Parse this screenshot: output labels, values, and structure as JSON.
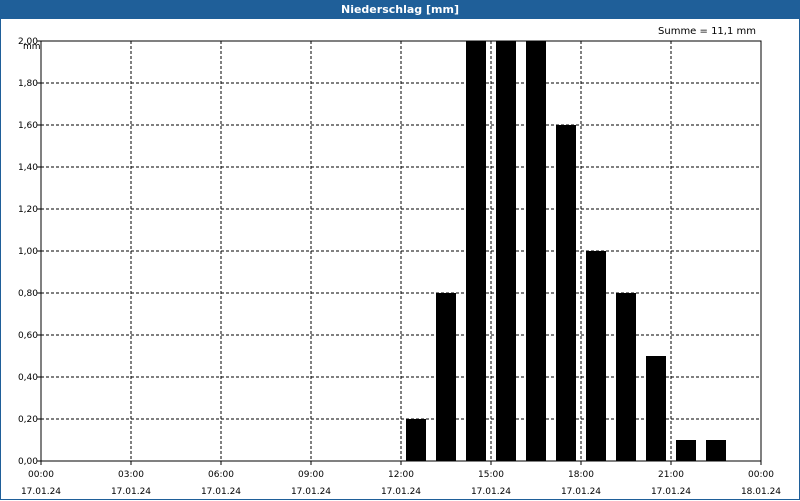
{
  "window": {
    "title": "Niederschlag [mm]"
  },
  "summary": {
    "text": "Summe = 11,1 mm"
  },
  "chart_data": {
    "type": "bar",
    "title": "Niederschlag [mm]",
    "ylabel": "mm",
    "xlabel": "",
    "ylim": [
      0,
      2.0
    ],
    "y_ticks": [
      "0,00",
      "0,20",
      "0,40",
      "0,60",
      "0,80",
      "1,00",
      "1,20",
      "1,40",
      "1,60",
      "1,80",
      "2,00"
    ],
    "x_ticks": [
      {
        "time": "00:00",
        "date": "17.01.24"
      },
      {
        "time": "03:00",
        "date": "17.01.24"
      },
      {
        "time": "06:00",
        "date": "17.01.24"
      },
      {
        "time": "09:00",
        "date": "17.01.24"
      },
      {
        "time": "12:00",
        "date": "17.01.24"
      },
      {
        "time": "15:00",
        "date": "17.01.24"
      },
      {
        "time": "18:00",
        "date": "17.01.24"
      },
      {
        "time": "21:00",
        "date": "17.01.24"
      },
      {
        "time": "00:00",
        "date": "18.01.24"
      }
    ],
    "categories": [
      "12:00",
      "13:00",
      "14:00",
      "15:00",
      "16:00",
      "17:00",
      "18:00",
      "19:00",
      "20:00",
      "21:00",
      "22:00"
    ],
    "values": [
      0.2,
      0.8,
      2.0,
      2.0,
      2.0,
      1.6,
      1.0,
      0.8,
      0.5,
      0.1,
      0.1
    ],
    "grid": true,
    "bar_color": "#000000",
    "accent_color": "#1f5f99"
  }
}
